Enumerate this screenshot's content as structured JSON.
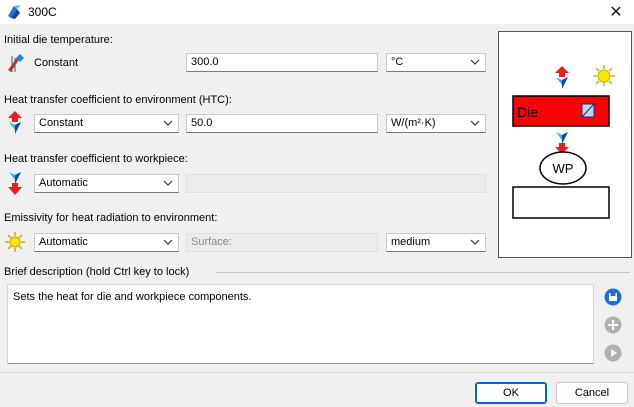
{
  "window": {
    "title": "300C",
    "close_glyph": "✕"
  },
  "rows": {
    "initial_temp": {
      "label": "Initial die temperature:",
      "mode": "Constant",
      "value": "300.0",
      "unit": "°C"
    },
    "htc_env": {
      "label": "Heat transfer coefficient to environment (HTC):",
      "mode": "Constant",
      "value": "50.0",
      "unit": "W/(m²·K)"
    },
    "htc_workpiece": {
      "label": "Heat transfer coefficient to workpiece:",
      "mode": "Automatic",
      "value": ""
    },
    "emissivity": {
      "label": "Emissivity for heat radiation to environment:",
      "mode": "Automatic",
      "surface_placeholder": "Surface:",
      "surface_value": "medium"
    }
  },
  "schematic": {
    "die_label": "Die",
    "workpiece_label": "WP"
  },
  "description": {
    "header": "Brief description (hold Ctrl key to lock)",
    "text": "Sets the heat for die and workpiece components."
  },
  "buttons": {
    "ok": "OK",
    "cancel": "Cancel"
  },
  "icons": {
    "title": "hammer-gem-icon",
    "row1": "die-temperature-icon",
    "row2": "heat-transfer-environment-icon",
    "row3": "heat-transfer-workpiece-icon",
    "row4": "sun-radiation-icon",
    "save": "save-icon",
    "add": "add-icon",
    "next": "play-icon"
  },
  "colors": {
    "accent": "#0a64c8",
    "die": "#ff0000",
    "sun": "#ffe600",
    "heat_arrow": "#e52020"
  }
}
